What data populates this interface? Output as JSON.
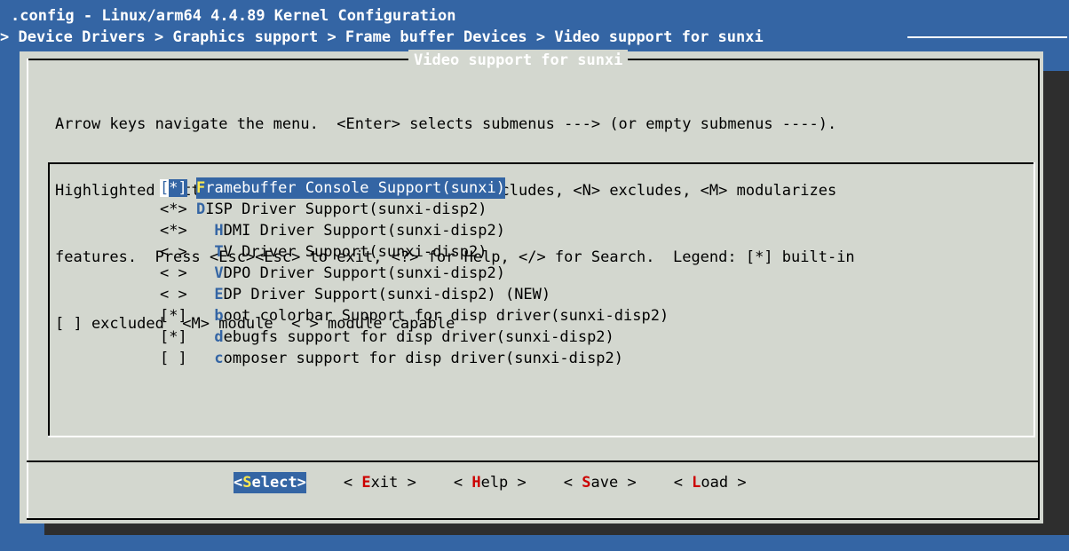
{
  "window": {
    "title": ".config - Linux/arm64 4.4.89 Kernel Configuration",
    "breadcrumb": "> Device Drivers > Graphics support > Frame buffer Devices > Video support for sunxi"
  },
  "dialog": {
    "title": "Video support for sunxi",
    "help_lines": [
      "Arrow keys navigate the menu.  <Enter> selects submenus ---> (or empty submenus ----).",
      "Highlighted letters are hotkeys.  Pressing <Y> includes, <N> excludes, <M> modularizes",
      "features.  Press <Esc><Esc> to exit, <?> for Help, </> for Search.  Legend: [*] built-in",
      "[ ] excluded  <M> module  < > module capable"
    ]
  },
  "menu": {
    "items": [
      {
        "prefix": "[*] ",
        "hotkey": "F",
        "rest": "ramebuffer Console Support(sunxi)",
        "selected": true
      },
      {
        "prefix": "<*> ",
        "hotkey": "D",
        "rest": "ISP Driver Support(sunxi-disp2)",
        "selected": false
      },
      {
        "prefix": "<*>   ",
        "hotkey": "H",
        "rest": "DMI Driver Support(sunxi-disp2)",
        "selected": false
      },
      {
        "prefix": "< >   ",
        "hotkey": "T",
        "rest": "V Driver Support(sunxi-disp2)",
        "selected": false
      },
      {
        "prefix": "< >   ",
        "hotkey": "V",
        "rest": "DPO Driver Support(sunxi-disp2)",
        "selected": false
      },
      {
        "prefix": "< >   ",
        "hotkey": "E",
        "rest": "DP Driver Support(sunxi-disp2) (NEW)",
        "selected": false
      },
      {
        "prefix": "[*]   ",
        "hotkey": "b",
        "rest": "oot colorbar Support for disp driver(sunxi-disp2)",
        "selected": false
      },
      {
        "prefix": "[*]   ",
        "hotkey": "d",
        "rest": "ebugfs support for disp driver(sunxi-disp2)",
        "selected": false
      },
      {
        "prefix": "[ ]   ",
        "hotkey": "c",
        "rest": "omposer support for disp driver(sunxi-disp2)",
        "selected": false
      }
    ]
  },
  "buttons": [
    {
      "pre": "<",
      "hk": "S",
      "post": "elect>",
      "active": true
    },
    {
      "pre": "< ",
      "hk": "E",
      "post": "xit >",
      "active": false
    },
    {
      "pre": "< ",
      "hk": "H",
      "post": "elp >",
      "active": false
    },
    {
      "pre": "< ",
      "hk": "S",
      "post": "ave >",
      "active": false
    },
    {
      "pre": "< ",
      "hk": "L",
      "post": "oad >",
      "active": false
    }
  ],
  "colors": {
    "background": "#3465a4",
    "dialog": "#d3d7cf",
    "hotkey": "#cc0000",
    "highlight": "#fce94f"
  }
}
